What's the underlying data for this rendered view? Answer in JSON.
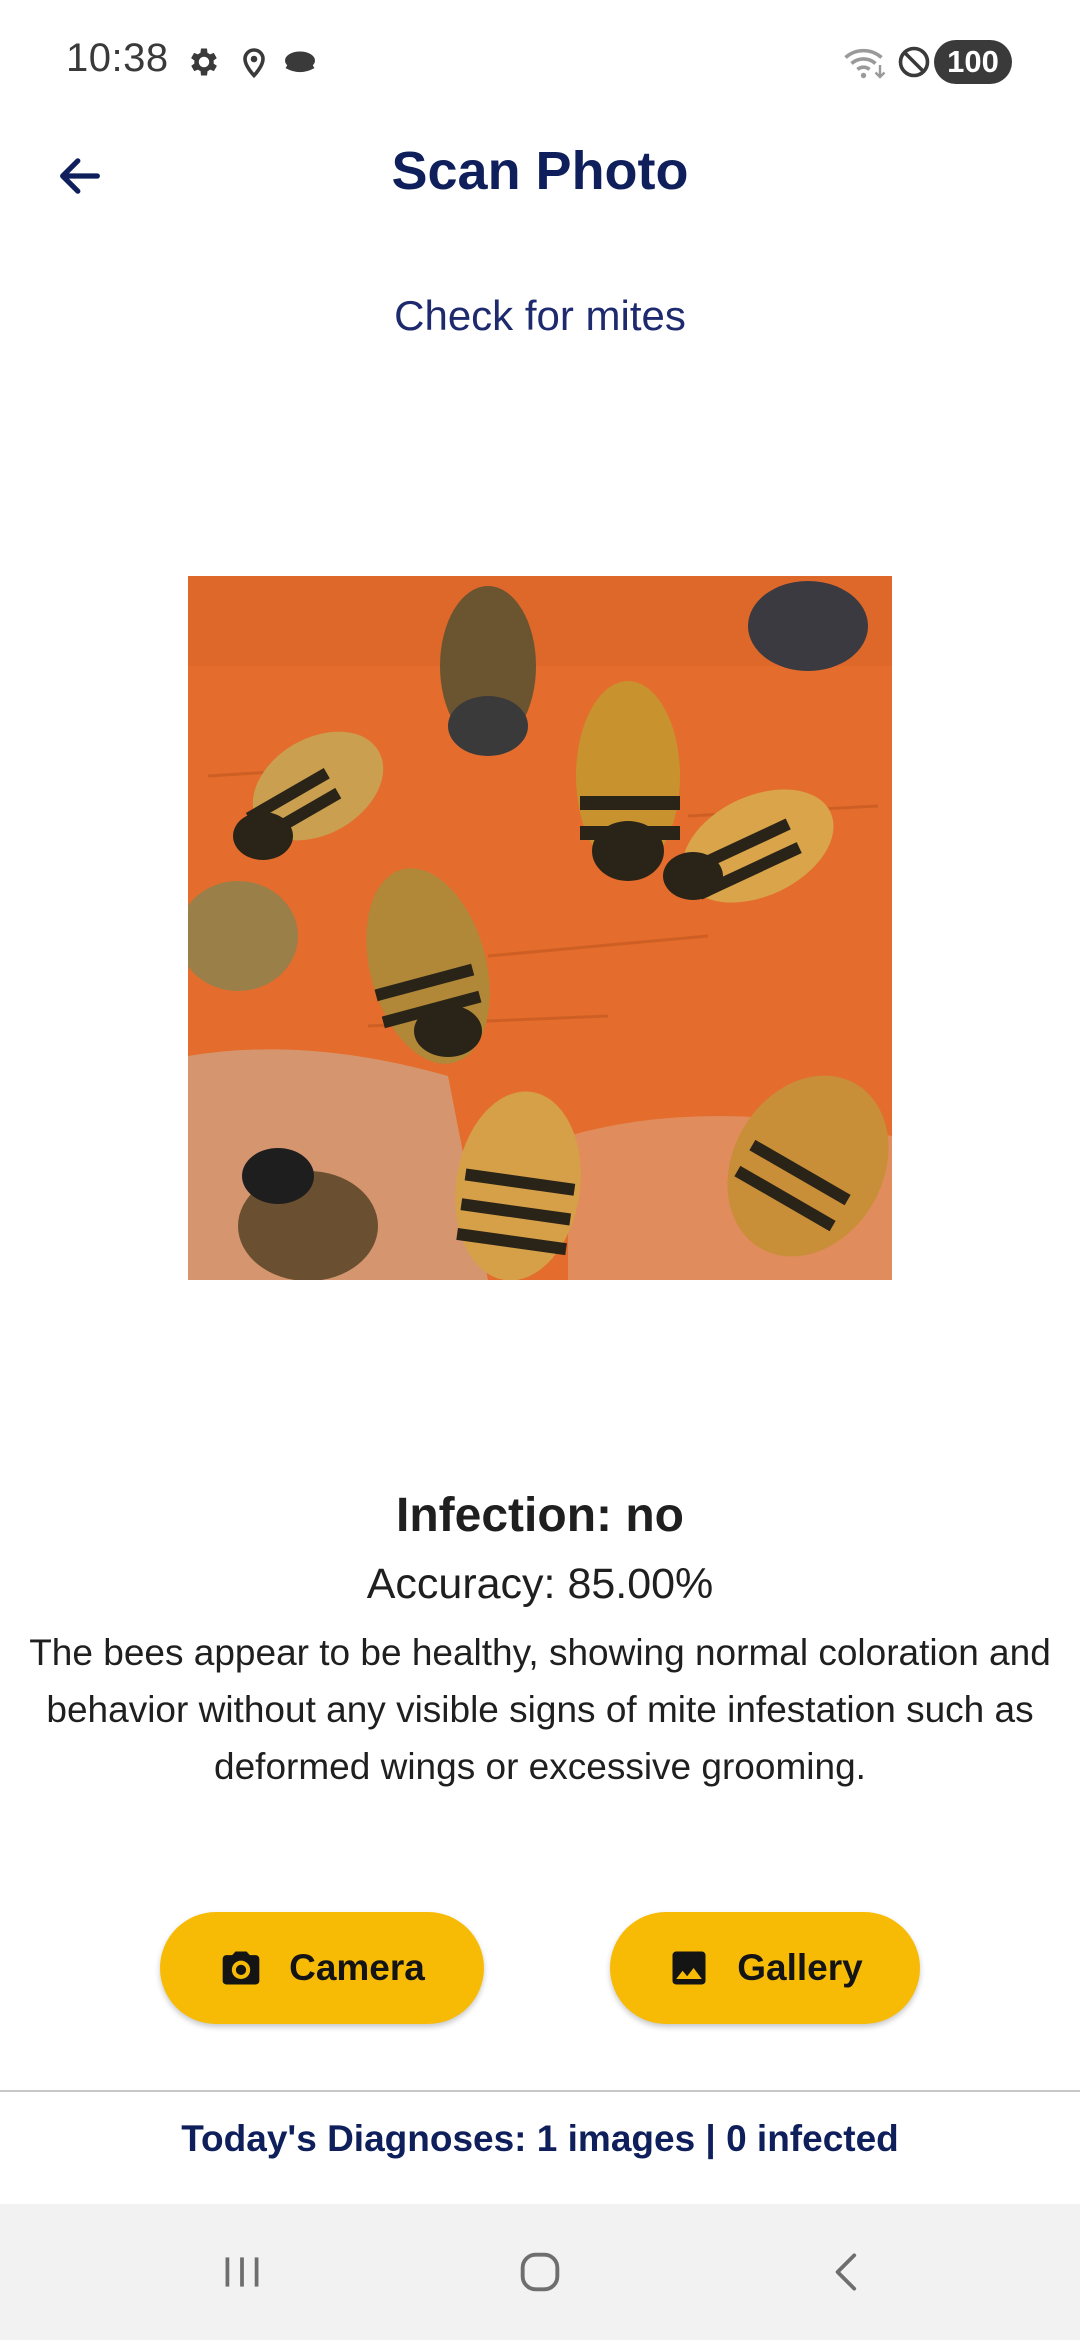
{
  "status_bar": {
    "time": "10:38",
    "icons": [
      "gear-icon",
      "location-icon",
      "cloud-icon",
      "wifi-icon",
      "do-not-disturb-icon"
    ],
    "battery": "100"
  },
  "header": {
    "title": "Scan Photo",
    "back_icon": "arrow-left-icon"
  },
  "subtitle": "Check for mites",
  "result": {
    "title": "Infection: no",
    "accuracy": "Accuracy: 85.00%",
    "description": "The bees appear to be healthy, showing normal coloration and behavior without any visible signs of mite infestation such as deformed wings or excessive grooming."
  },
  "buttons": {
    "camera_label": "Camera",
    "gallery_label": "Gallery"
  },
  "footer": {
    "stats": "Today's Diagnoses: 1 images | 0 infected"
  },
  "colors": {
    "accent": "#f8bb05",
    "primary_text": "#0f1f5c",
    "photo_background": "#e06a2a"
  }
}
